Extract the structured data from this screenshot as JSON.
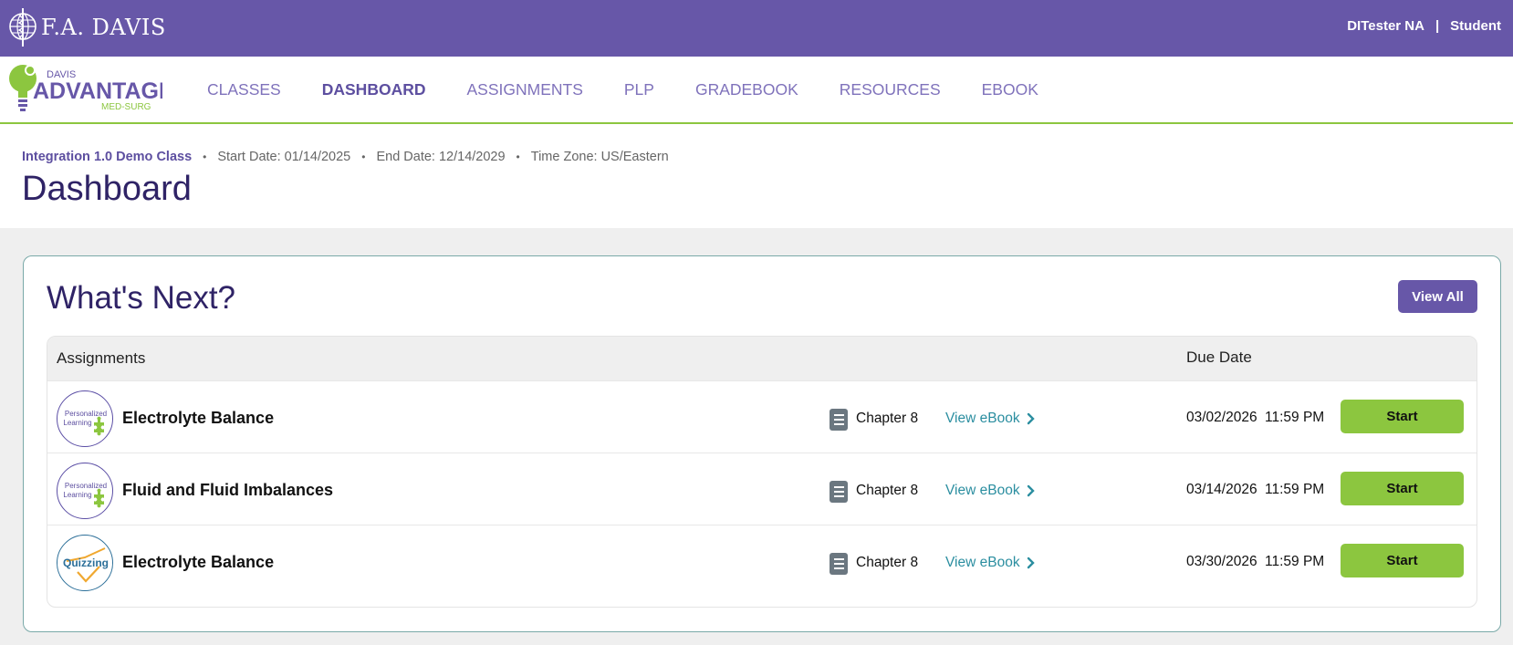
{
  "topbar": {
    "brand": "F.A. DAVIS",
    "user_name": "DITester NA",
    "separator": "|",
    "user_role": "Student"
  },
  "logo": {
    "top": "DAVIS",
    "main": "ADVANTAGE",
    "sub": "MED-SURG"
  },
  "nav": {
    "items": [
      {
        "label": "CLASSES",
        "active": false
      },
      {
        "label": "DASHBOARD",
        "active": true
      },
      {
        "label": "ASSIGNMENTS",
        "active": false
      },
      {
        "label": "PLP",
        "active": false
      },
      {
        "label": "GRADEBOOK",
        "active": false
      },
      {
        "label": "RESOURCES",
        "active": false
      },
      {
        "label": "EBOOK",
        "active": false
      }
    ]
  },
  "header": {
    "class_name": "Integration 1.0 Demo Class",
    "start_date": "Start Date: 01/14/2025",
    "end_date": "End Date: 12/14/2029",
    "time_zone": "Time Zone: US/Eastern",
    "dot": "•",
    "title": "Dashboard"
  },
  "whats_next": {
    "title": "What's Next?",
    "view_all_label": "View All",
    "col_assignments": "Assignments",
    "col_due": "Due Date",
    "rows": [
      {
        "icon": "personalized-learning-icon",
        "icon_line1": "Personalized",
        "icon_line2": "Learning",
        "title": "Electrolyte Balance",
        "chapter": "Chapter 8",
        "ebook": "View eBook",
        "date": "03/02/2026",
        "time": "11:59 PM",
        "action": "Start"
      },
      {
        "icon": "personalized-learning-icon",
        "icon_line1": "Personalized",
        "icon_line2": "Learning",
        "title": "Fluid and Fluid Imbalances",
        "chapter": "Chapter 8",
        "ebook": "View eBook",
        "date": "03/14/2026",
        "time": "11:59 PM",
        "action": "Start"
      },
      {
        "icon": "quizzing-icon",
        "icon_line1": "Quizzing",
        "icon_line2": "",
        "title": "Electrolyte Balance",
        "chapter": "Chapter 8",
        "ebook": "View eBook",
        "date": "03/30/2026",
        "time": "11:59 PM",
        "action": "Start"
      }
    ]
  },
  "colors": {
    "brand_purple": "#6757a8",
    "accent_green": "#8cc63f",
    "link_teal": "#2b8ea0",
    "title_navy": "#2f2366"
  }
}
